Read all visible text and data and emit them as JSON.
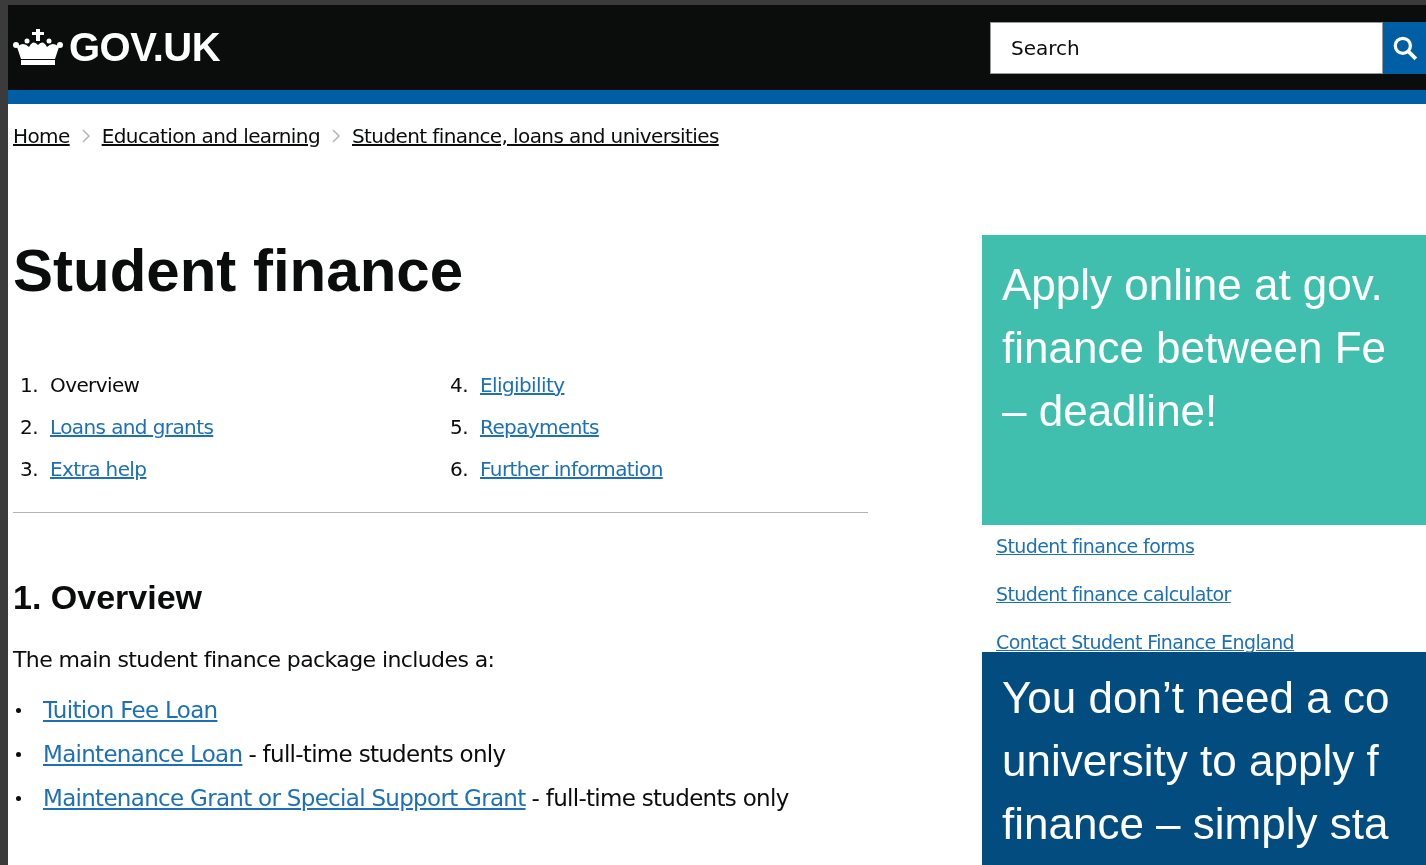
{
  "header": {
    "logo": "GOV.UK",
    "search": {
      "placeholder": "Search"
    }
  },
  "breadcrumbs": [
    "Home",
    "Education and learning",
    "Student finance, loans and universities"
  ],
  "title": "Student finance",
  "contents": [
    {
      "number": "1.",
      "label": "Overview",
      "selected": true
    },
    {
      "number": "2.",
      "label": "Loans and grants",
      "selected": false
    },
    {
      "number": "3.",
      "label": "Extra help",
      "selected": false
    },
    {
      "number": "4.",
      "label": "Eligibility",
      "selected": false
    },
    {
      "number": "5.",
      "label": "Repayments",
      "selected": false
    },
    {
      "number": "6.",
      "label": "Further information",
      "selected": false
    }
  ],
  "section": {
    "heading": "1. Overview",
    "intro": "The main student finance package includes a:",
    "items": [
      {
        "link": "Tuition Fee Loan"
      },
      {
        "link": "Maintenance Loan",
        "note": "- full-time students only"
      },
      {
        "link": "Maintenance Grant or Special Support Grant",
        "note": "- full-time students only"
      }
    ]
  },
  "callouts": [
    {
      "kind": "teal",
      "lines": [
        "Apply online at gov.",
        "finance between Fe",
        "– deadline!"
      ]
    },
    {
      "kind": "navy",
      "lines": [
        "You don’t need a co",
        "university to apply f",
        "finance – simply sta"
      ]
    }
  ],
  "related_links": [
    "Student finance forms",
    "Student finance calculator",
    "Contact Student Finance England"
  ]
}
